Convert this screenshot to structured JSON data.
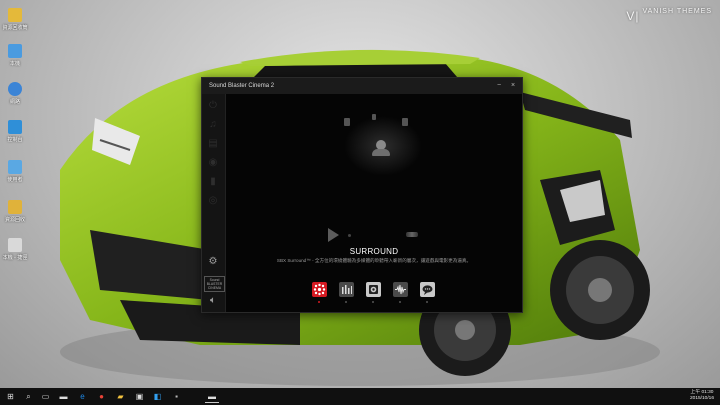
{
  "app": {
    "title": "Sound Blaster Cinema 2",
    "minimize_glyph": "−",
    "close_glyph": "×",
    "sidebar": {
      "items": [
        {
          "icon": "power-icon"
        },
        {
          "icon": "music-icon"
        },
        {
          "icon": "film-icon"
        },
        {
          "icon": "gamepad-icon"
        },
        {
          "icon": "microphone-icon"
        },
        {
          "icon": "broadcast-icon"
        }
      ],
      "settings_icon": "gear-icon",
      "logo_text": "Sound BLASTER CINEMA",
      "volume_icon": "speaker-icon"
    },
    "main": {
      "mode_title": "SURROUND",
      "mode_description": "SBX Surround™ - 全方位的環繞體驗為多媒體的聆聽帶入嶄新的層次，讓遊戲與電影更為逼真。",
      "features": [
        {
          "name": "surround",
          "icon": "surround-dots-icon",
          "active": true,
          "color": "#d51a22"
        },
        {
          "name": "crystalizer",
          "icon": "equalizer-bars-icon",
          "active": false,
          "color": "#4a4a4a"
        },
        {
          "name": "bass",
          "icon": "bass-speaker-icon",
          "active": false,
          "color": "#c9c9c9"
        },
        {
          "name": "smart-volume",
          "icon": "waveform-icon",
          "active": false,
          "color": "#4a4a4a"
        },
        {
          "name": "dialog-plus",
          "icon": "chat-bubble-icon",
          "active": false,
          "color": "#c9c9c9"
        }
      ]
    }
  },
  "desktop": {
    "brand": "VANISH THEMES",
    "icons": [
      {
        "label": "資源回收筒",
        "icon": "folder-icon",
        "color": "#e4b93a"
      },
      {
        "label": "本機",
        "icon": "computer-icon",
        "color": "#4a9be0"
      },
      {
        "label": "網路",
        "icon": "network-icon",
        "color": "#3b84d6"
      },
      {
        "label": "控制台",
        "icon": "control-panel-icon",
        "color": "#2f8fd8"
      },
      {
        "label": "使用者",
        "icon": "user-folder-icon",
        "color": "#5aa8e3"
      },
      {
        "label": "資源回收",
        "icon": "folder-icon",
        "color": "#e0b23a"
      },
      {
        "label": "本機 - 捷徑",
        "icon": "document-icon",
        "color": "#d9d9d9"
      }
    ]
  },
  "taskbar": {
    "start_icon": "windows-start-icon",
    "search_icon": "search-icon",
    "apps": [
      {
        "icon": "task-view-icon"
      },
      {
        "icon": "edge-icon"
      },
      {
        "icon": "chrome-icon"
      },
      {
        "icon": "file-explorer-icon"
      },
      {
        "icon": "store-icon"
      },
      {
        "icon": "photoshop-icon"
      },
      {
        "icon": "sound-blaster-icon"
      }
    ],
    "clock_time": "上午 01:30",
    "clock_date": "2015/10/16"
  },
  "colors": {
    "accent_red": "#d51a22",
    "car_green": "#86b61a",
    "window_bg": "#050505"
  }
}
